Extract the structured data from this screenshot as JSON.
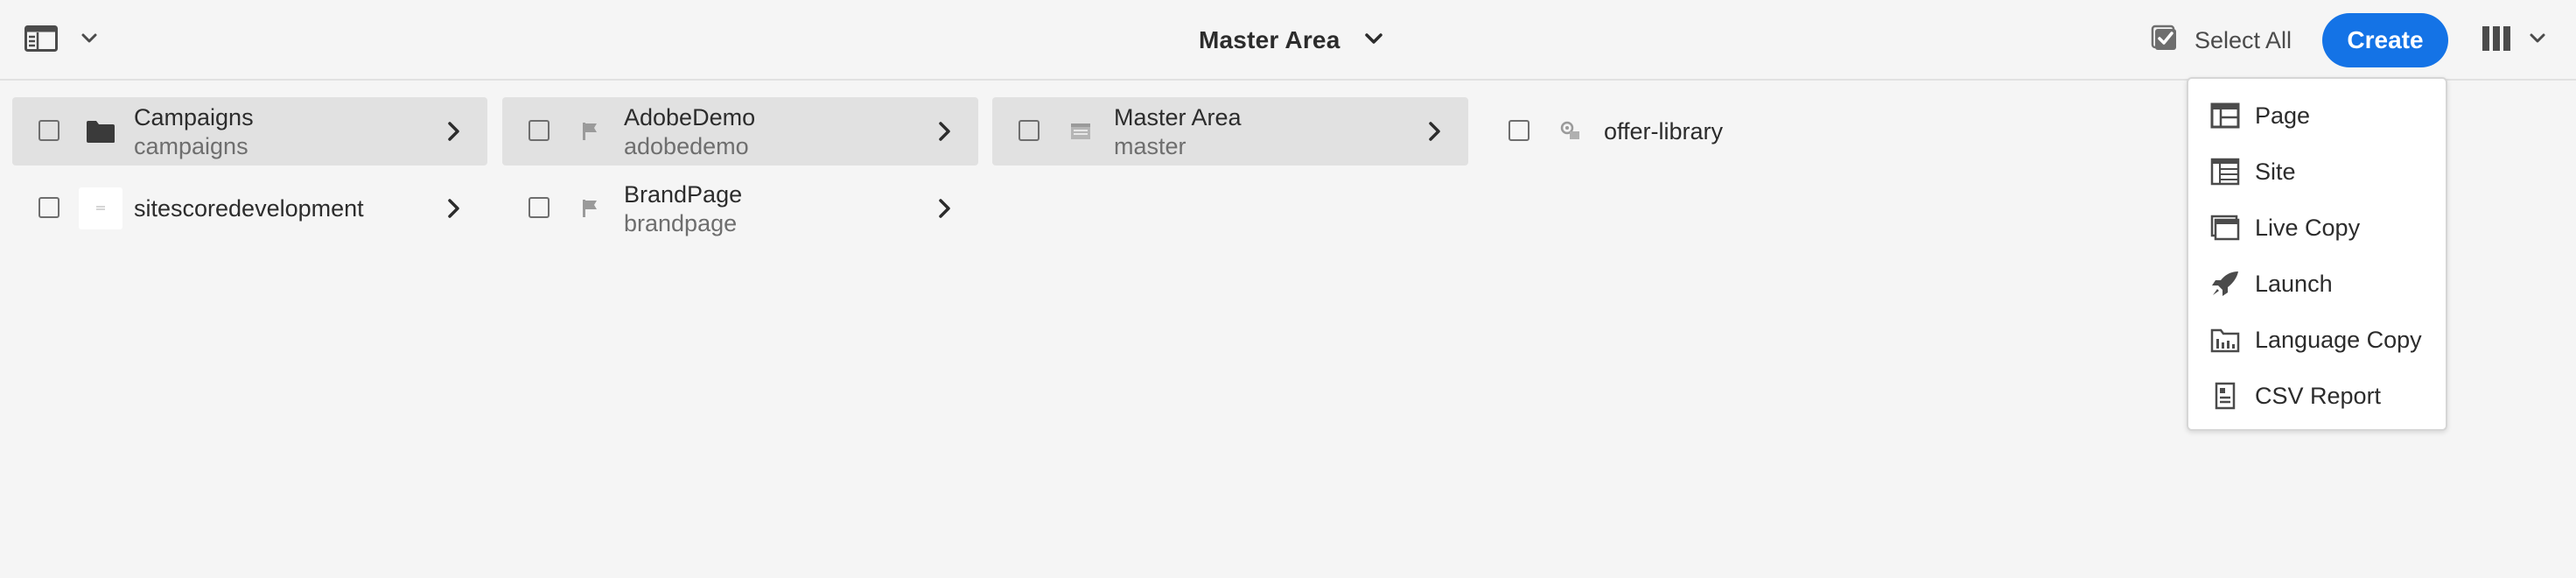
{
  "header": {
    "title": "Master Area",
    "select_all_label": "Select All",
    "create_label": "Create"
  },
  "columns": {
    "row1": [
      {
        "name": "Campaigns",
        "sub": "campaigns",
        "icon": "folder-icon",
        "selected": true,
        "has_children": true
      },
      {
        "name": "AdobeDemo",
        "sub": "adobedemo",
        "icon": "flag-icon",
        "selected": true,
        "has_children": true
      },
      {
        "name": "Master Area",
        "sub": "master",
        "icon": "page-icon",
        "selected": true,
        "has_children": true
      },
      {
        "name": "offer-library",
        "sub": "",
        "icon": "offer-icon",
        "selected": false,
        "has_children": false
      }
    ],
    "row2": [
      {
        "name": "sitescoredevelopment",
        "sub": "",
        "icon": "thumbnail-icon",
        "selected": false,
        "has_children": true
      },
      {
        "name": "BrandPage",
        "sub": "brandpage",
        "icon": "flag-icon",
        "selected": false,
        "has_children": true
      }
    ]
  },
  "create_menu": {
    "items": [
      {
        "label": "Page",
        "icon": "page-layout-icon"
      },
      {
        "label": "Site",
        "icon": "site-icon"
      },
      {
        "label": "Live Copy",
        "icon": "live-copy-icon"
      },
      {
        "label": "Launch",
        "icon": "rocket-icon"
      },
      {
        "label": "Language Copy",
        "icon": "language-copy-icon"
      },
      {
        "label": "CSV Report",
        "icon": "report-icon"
      }
    ]
  },
  "colors": {
    "accent": "#1473e6",
    "background": "#f5f5f5",
    "selected_row": "#e1e1e1",
    "text": "#2c2c2c",
    "muted_text": "#6e6e6e"
  }
}
